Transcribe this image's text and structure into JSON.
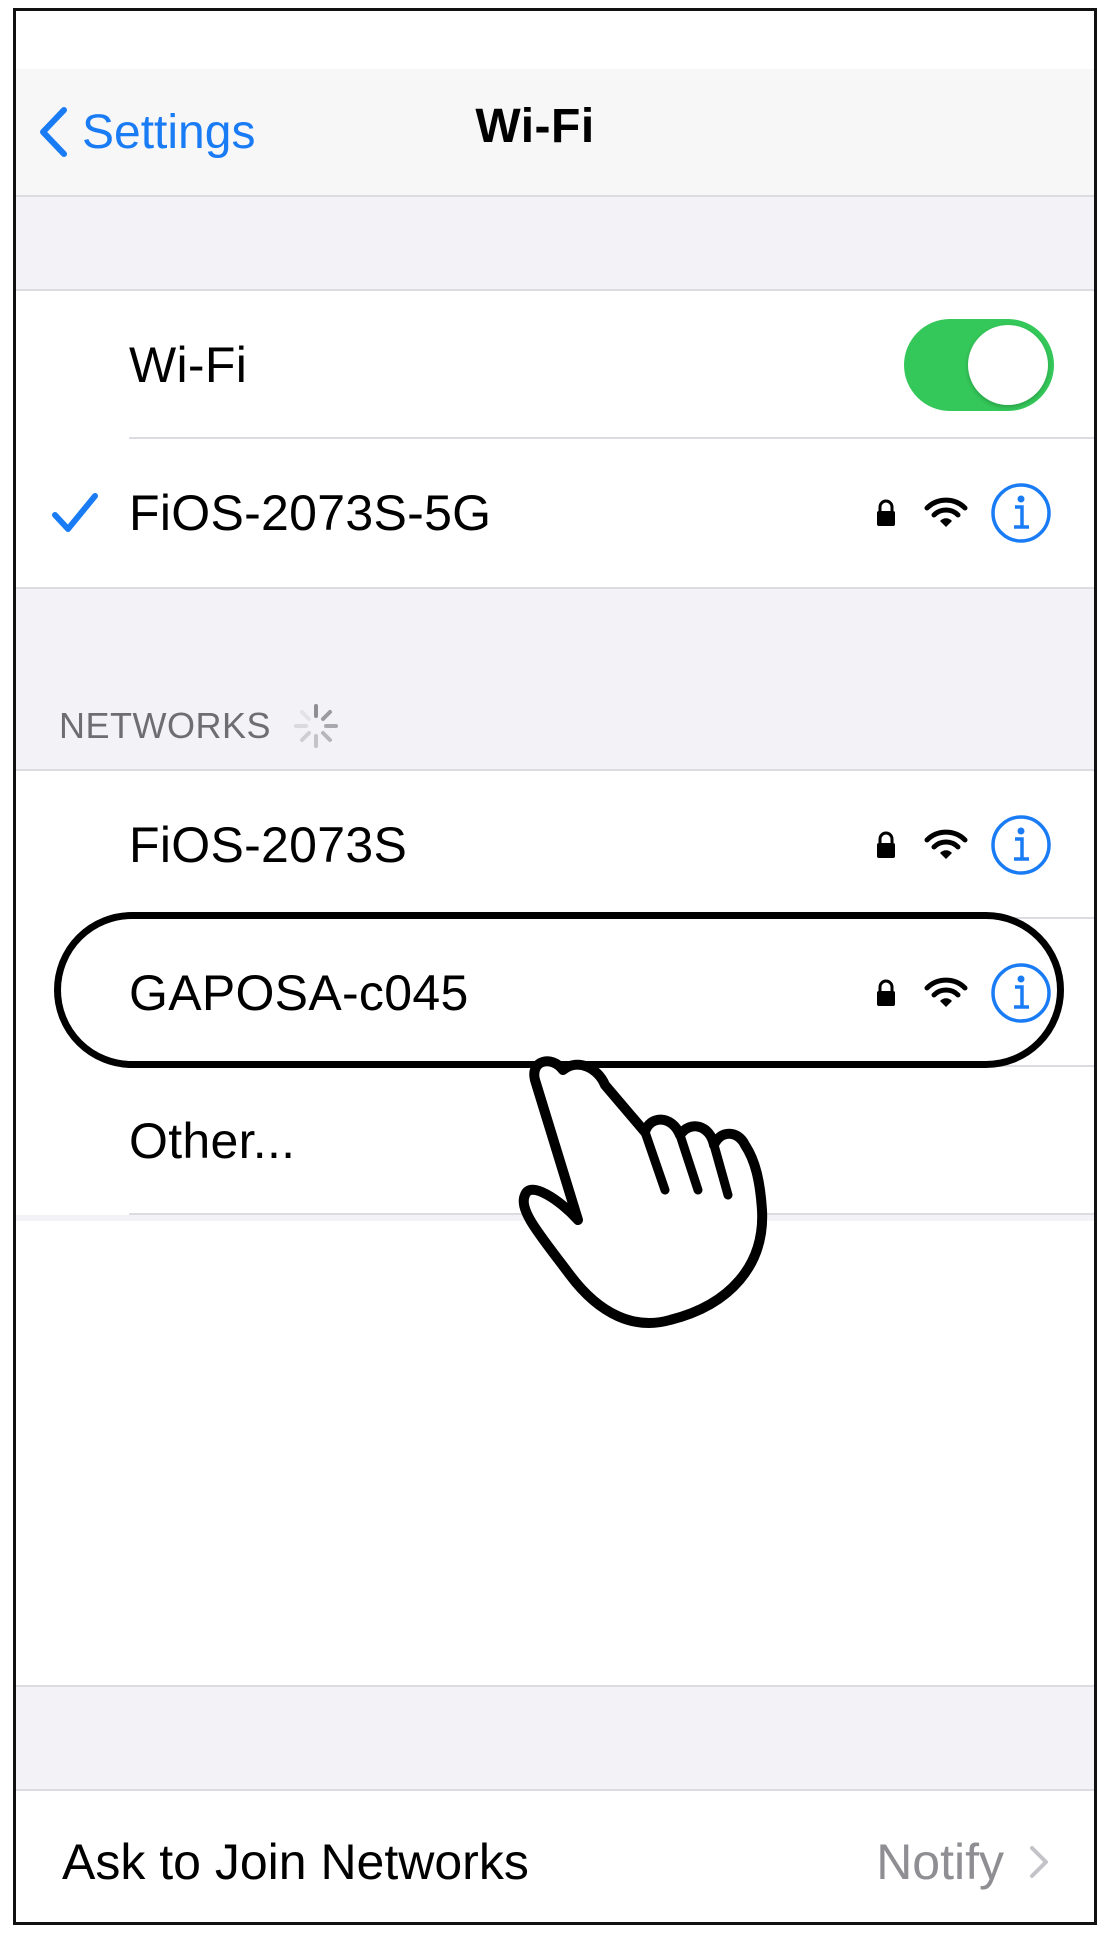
{
  "nav": {
    "back_label": "Settings",
    "title": "Wi-Fi"
  },
  "wifi_toggle": {
    "label": "Wi-Fi",
    "on": true
  },
  "connected_network": {
    "name": "FiOS-2073S-5G",
    "icons": [
      "checkmark-icon",
      "lock-icon",
      "wifi-icon",
      "info-icon"
    ]
  },
  "networks_section": {
    "header": "NETWORKS",
    "items": [
      {
        "name": "FiOS-2073S",
        "icons": [
          "lock-icon",
          "wifi-icon",
          "info-icon"
        ]
      },
      {
        "name": "GAPOSA-c045",
        "icons": [
          "lock-icon",
          "wifi-icon",
          "info-icon"
        ],
        "highlighted": true
      }
    ],
    "other_label": "Other..."
  },
  "ask_to_join": {
    "label": "Ask to Join Networks",
    "value": "Notify"
  },
  "colors": {
    "accent": "#1a7cf5",
    "toggle_on": "#34c759",
    "secondary_text": "#8e8e93",
    "grouped_background": "#f2f2f7"
  },
  "annotation": {
    "highlight": "oval-outline",
    "pointer": "hand-pointer-icon"
  }
}
